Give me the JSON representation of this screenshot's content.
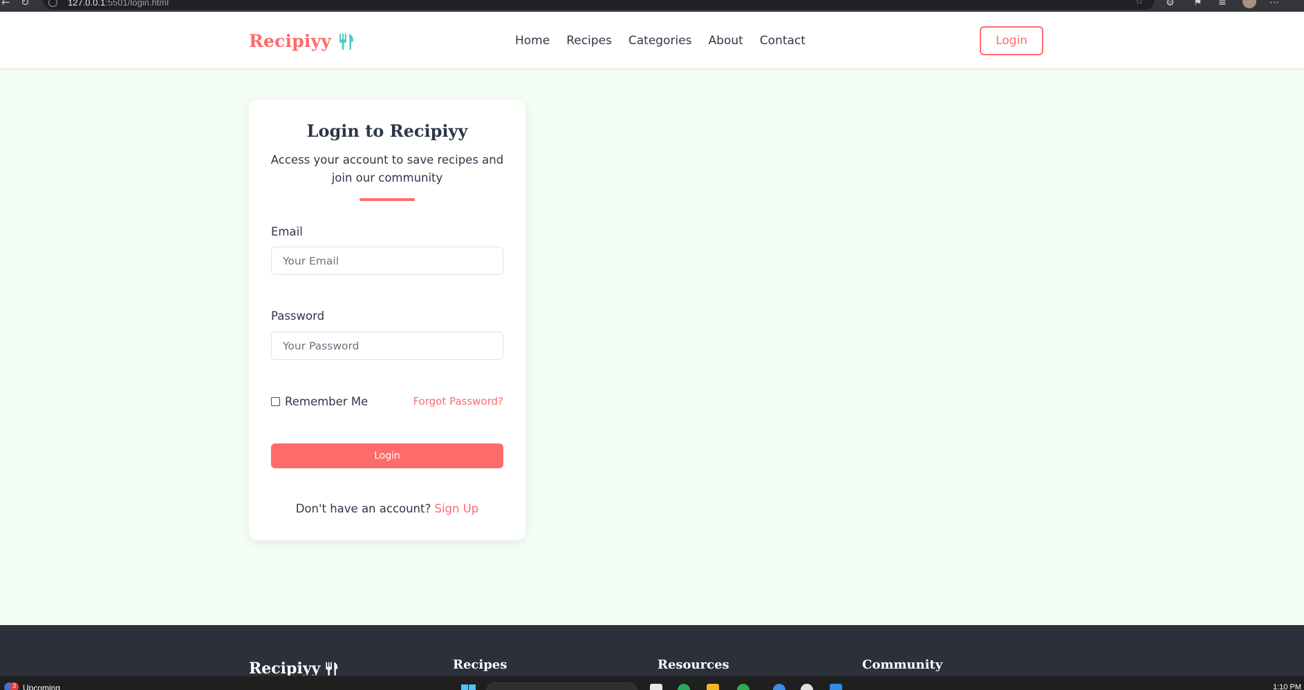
{
  "browser": {
    "url_host": "127.0.0.1",
    "url_rest": ":5501/login.html"
  },
  "header": {
    "brand": "Recipiyy",
    "nav": [
      "Home",
      "Recipes",
      "Categories",
      "About",
      "Contact"
    ],
    "login_label": "Login"
  },
  "login_card": {
    "title": "Login to Recipiyy",
    "subtitle": "Access your account to save recipes and join our community",
    "email_label": "Email",
    "email_placeholder": "Your Email",
    "password_label": "Password",
    "password_placeholder": "Your Password",
    "remember_label": "Remember Me",
    "forgot_label": "Forgot Password?",
    "submit_label": "Login",
    "signup_prompt": "Don't have an account?",
    "signup_link": "Sign Up"
  },
  "footer": {
    "brand": "Recipiyy",
    "columns": [
      "Recipes",
      "Resources",
      "Community"
    ]
  },
  "taskbar": {
    "notification_count": "3",
    "widget_label": "Upcoming",
    "clock": "1:10 PM"
  },
  "colors": {
    "accent": "#ff6b6b",
    "teal": "#4ecdc4",
    "page_bg": "#f3fdf3",
    "footer_bg": "#2b303a"
  }
}
